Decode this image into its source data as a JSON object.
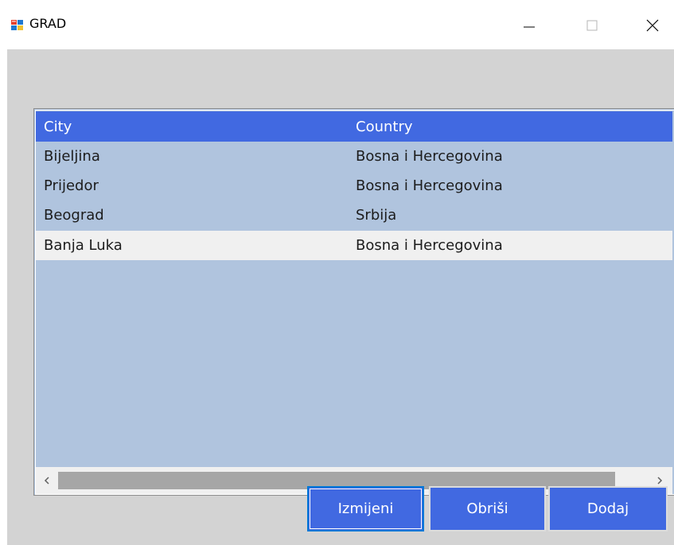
{
  "window": {
    "title": "GRAD",
    "icon": "winforms-app-icon",
    "controls": {
      "minimize_icon": "minimize-icon",
      "maximize_icon": "maximize-icon",
      "close_icon": "close-icon"
    }
  },
  "grid": {
    "columns": [
      "City",
      "Country"
    ],
    "rows": [
      {
        "city": "Bijeljina",
        "country": "Bosna i Hercegovina"
      },
      {
        "city": "Prijedor",
        "country": "Bosna i Hercegovina"
      },
      {
        "city": "Beograd",
        "country": "Srbija"
      },
      {
        "city": "Banja Luka",
        "country": "Bosna i Hercegovina"
      }
    ],
    "selected_row": 3,
    "scroll_left_icon": "chevron-left-icon",
    "scroll_right_icon": "chevron-right-icon"
  },
  "buttons": {
    "edit_label": "Izmijeni",
    "delete_label": "Obriši",
    "add_label": "Dodaj"
  },
  "colors": {
    "client_bg": "#d3d3d3",
    "grid_bg": "#b0c4de",
    "header_bg": "#4169e1",
    "selected_row_bg": "#f0f0f0",
    "button_bg": "#4169e1"
  }
}
